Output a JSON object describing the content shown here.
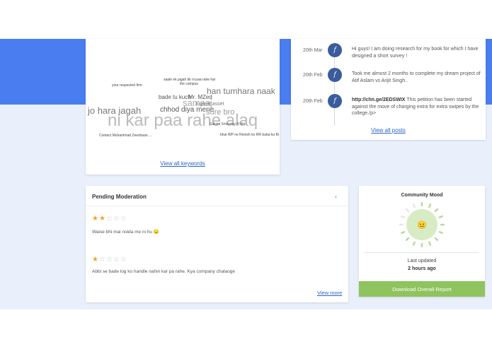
{
  "keywords": {
    "words": [
      {
        "text": "saale ek jagah tik ni paa rahe hai",
        "color": "#444"
      },
      {
        "text": "the campus",
        "color": "#444"
      },
      {
        "text": "your respected firm",
        "color": "#444"
      },
      {
        "text": "han tumhara naak",
        "color": "#777"
      },
      {
        "text": "bade tu kuch",
        "color": "#555"
      },
      {
        "text": "Mr. MZed",
        "color": "#555"
      },
      {
        "text": "samaaj",
        "color": "#aaa"
      },
      {
        "text": "a great asset",
        "color": "#777"
      },
      {
        "text": "jo hara jagah",
        "color": "#777"
      },
      {
        "text": "chhod diya mene",
        "color": "#555"
      },
      {
        "text": "sure bro",
        "color": "#999"
      },
      {
        "text": "ni kar paa rahe alaq",
        "color": "#bbb"
      },
      {
        "text": "Sakshi Srivastav R bhi",
        "color": "#555"
      },
      {
        "text": "Contact Muhammad Zeeshaan ...",
        "color": "#444"
      },
      {
        "text": "bhai WP ne Renish ko RR baba ku Bi",
        "color": "#444"
      }
    ],
    "view_all_label": "View all keywords"
  },
  "posts": {
    "icon_glyph": "f",
    "items": [
      {
        "date": "20th Mar",
        "text": "Hi guys! I am doing research for my book for which I have designed a short survey !"
      },
      {
        "date": "20th Feb",
        "text": "Took me almost 2 months to complete my dream project of Atif Aslam vs Arijit Singh.."
      },
      {
        "date": "20th Feb",
        "link": "http://chn.ge/2EDSWIX",
        "text": " This petition has been started against the move of charging extra for extra swipes by the college./p>"
      }
    ],
    "view_all_label": "View all posts"
  },
  "moderation": {
    "title": "Pending Moderation",
    "chevron": "‹",
    "items": [
      {
        "rating": 2,
        "max": 5,
        "text": "Waise bhi mai noida me ni hu 😞"
      },
      {
        "rating": 1,
        "max": 5,
        "text": "Abbi se bade log ko handle nahin kar pa rahe. Kya company chalaoge"
      }
    ],
    "view_more_label": "View more"
  },
  "mood": {
    "title": "Community Mood",
    "face": "😐",
    "level": 0.75,
    "updated_label": "Last updated",
    "updated_time": "2 hours ago",
    "download_label": "Download Overall Report",
    "colors": {
      "ring": "#b8d99a",
      "fill": "#d7ebc5",
      "face": "#f2c14e",
      "button": "#8fc35d"
    }
  },
  "colors": {
    "brand_blue": "#4a7ef0",
    "background": "#e9f0fb",
    "link": "#2a65c7",
    "star": "#f0a32a"
  }
}
